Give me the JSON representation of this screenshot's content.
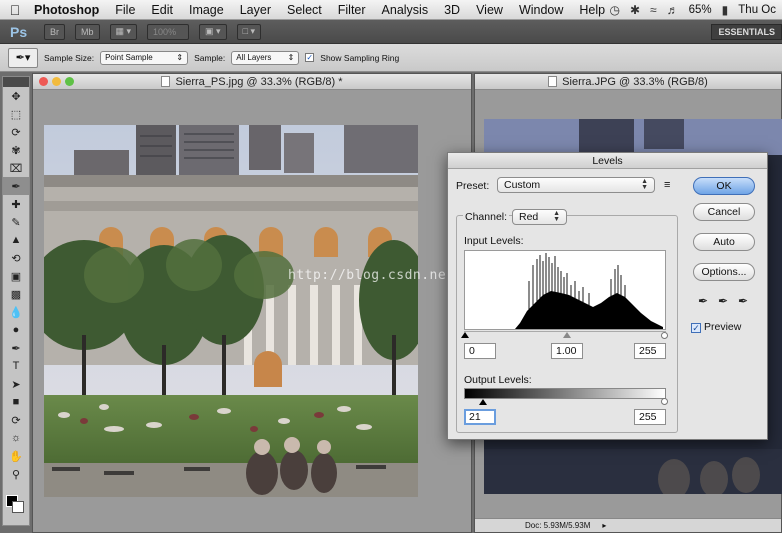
{
  "menubar": {
    "app_name": "Photoshop",
    "items": [
      "File",
      "Edit",
      "Image",
      "Layer",
      "Select",
      "Filter",
      "Analysis",
      "3D",
      "View",
      "Window",
      "Help"
    ],
    "battery": "65%",
    "clock": "Thu Oc"
  },
  "appbar": {
    "logo": "Ps",
    "zoom": "100%",
    "workspace": "ESSENTIALS"
  },
  "options": {
    "sample_size_label": "Sample Size:",
    "sample_size_value": "Point Sample",
    "sample_label": "Sample:",
    "sample_value": "All Layers",
    "show_ring_label": "Show Sampling Ring",
    "show_ring_checked": true
  },
  "documents": {
    "left_title": "Sierra_PS.jpg @ 33.3% (RGB/8) *",
    "right_title": "Sierra.JPG @ 33.3% (RGB/8)",
    "right_status": "Doc: 5.93M/5.93M"
  },
  "levels": {
    "title": "Levels",
    "preset_label": "Preset:",
    "preset_value": "Custom",
    "channel_label": "Channel:",
    "channel_value": "Red",
    "input_label": "Input Levels:",
    "input_black": "0",
    "input_gamma": "1.00",
    "input_white": "255",
    "output_label": "Output Levels:",
    "output_black": "21",
    "output_white": "255",
    "ok": "OK",
    "cancel": "Cancel",
    "auto": "Auto",
    "options": "Options...",
    "preview_label": "Preview",
    "preview_checked": true
  },
  "watermark": "http://blog.csdn.net/",
  "icons": {
    "apple": "apple-icon",
    "eyedropper": "eyedropper-icon"
  }
}
